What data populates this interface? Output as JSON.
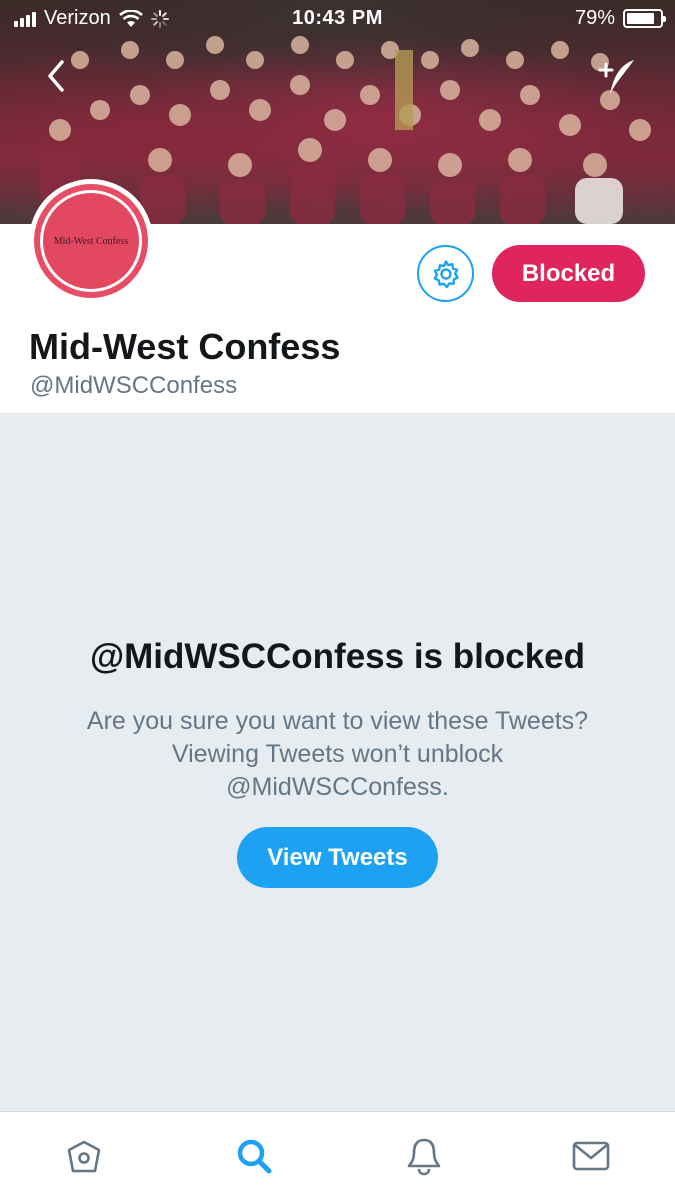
{
  "status_bar": {
    "carrier": "Verizon",
    "time": "10:43 PM",
    "battery": "79%",
    "battery_level": 0.79
  },
  "header": {
    "back_icon": "chevron-left-icon",
    "compose_icon": "compose-tweet-icon"
  },
  "profile": {
    "avatar_text": "Mid-West Confess",
    "display_name": "Mid-West Confess",
    "handle": "@MidWSCConfess",
    "blocked_label": "Blocked",
    "settings_icon": "gear-icon"
  },
  "blocked_notice": {
    "title": "@MidWSCConfess is blocked",
    "message": "Are you sure you want to view these Tweets? Viewing Tweets won’t unblock @MidWSCConfess.",
    "view_button": "View Tweets"
  },
  "tab_bar": {
    "tabs": [
      {
        "icon": "home-icon",
        "active": false
      },
      {
        "icon": "search-icon",
        "active": true
      },
      {
        "icon": "bell-icon",
        "active": false
      },
      {
        "icon": "mail-icon",
        "active": false
      }
    ]
  },
  "colors": {
    "accent": "#1da1f2",
    "blocked": "#e0245e",
    "avatar": "#e84d66",
    "background_gray": "#e6ecf0",
    "secondary_text": "#657786"
  }
}
